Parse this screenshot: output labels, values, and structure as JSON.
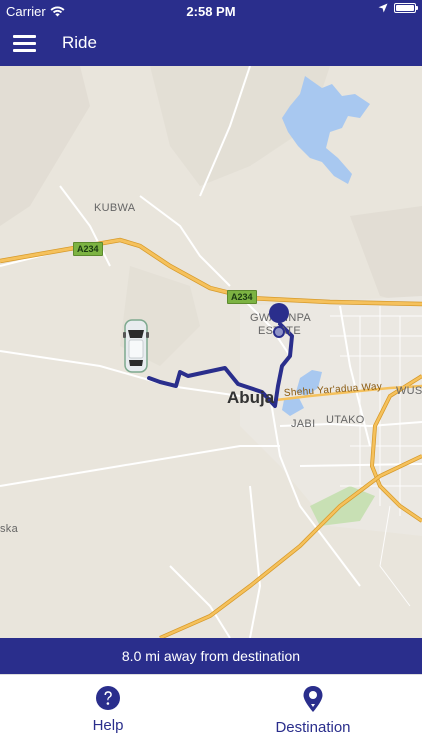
{
  "status_bar": {
    "carrier": "Carrier",
    "time": "2:58 PM",
    "battery_level": 1.0
  },
  "nav": {
    "title": "Ride",
    "menu_icon": "hamburger-menu-icon"
  },
  "map": {
    "labels": {
      "kubwa": "KUBWA",
      "gwarinpa_line1": "GWARINPA",
      "gwarinpa_line2": "ESTATE",
      "abuja": "Abuja",
      "jabi": "JABI",
      "utako": "UTAKO",
      "wuse": "WUSE",
      "shehu_road": "Shehu Yar'adua Way",
      "edge_label": "ska",
      "route_a234_1": "A234",
      "route_a234_2": "A234"
    },
    "colors": {
      "background": "#e9e5dc",
      "water": "#a8c8f0",
      "highway": "#f0b33c",
      "route": "#2a2e8c"
    },
    "icons": {
      "car": "car-icon",
      "destination_pin": "destination-pin-icon"
    }
  },
  "banner": {
    "distance_text": "8.0 mi away from destination"
  },
  "tabs": {
    "help_label": "Help",
    "destination_label": "Destination",
    "help_icon": "help-icon",
    "destination_icon": "location-pin-icon"
  },
  "theme": {
    "primary": "#2a2e8c"
  }
}
